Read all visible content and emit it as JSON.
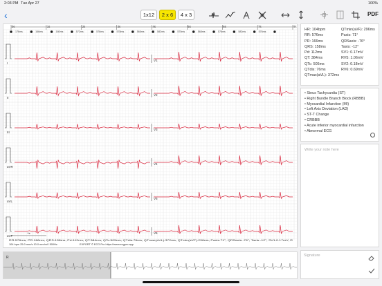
{
  "status_bar": {
    "time": "2:03 PM",
    "date": "Tue Apr 27",
    "battery": "100%"
  },
  "toolbar": {
    "back_label": "‹",
    "layouts": [
      "1x12",
      "2 x 6",
      "4 x 3"
    ],
    "active_layout": "2 x 6",
    "pdf_label": "PDF",
    "tools": [
      "waveform-icon",
      "trend-icon",
      "caliper-icon",
      "crossed-tool-icon",
      "horizontal-arrows-icon",
      "vertical-arrows-icon",
      "move-icon",
      "panel-icon",
      "crop-icon"
    ]
  },
  "ecg": {
    "time_marks": [
      "0s",
      "1s",
      "2s",
      "3s",
      "4s",
      "5s",
      "6s",
      "7s",
      "8s"
    ],
    "rr_labels": [
      "176ms",
      "166ms",
      "180ms",
      "572ms",
      "576ms",
      "578ms",
      "566ms",
      "582ms",
      "570ms",
      "568ms",
      "578ms",
      "582ms",
      "576ms",
      "580ms",
      "572ms",
      "574ms"
    ],
    "left_leads": [
      "I",
      "II",
      "III",
      "aVR",
      "aVL",
      "aVF"
    ],
    "right_leads": [
      "V1",
      "V2",
      "V3",
      "V4",
      "V5",
      "V6"
    ],
    "scale_label": "1s",
    "footer_line1": "RR:576ms; PR:166ms; QRS:158ms; Pd:112ms; QT:384ms; QTc:505ms; QTdis:76ms; QTmax(aVL):372ms; QTmin(aVF):296ms; Paxis:71°; QRSaxis:-76°; Taxis:-12°; SV1:0.17mV; R",
    "footer_line2": "104 bpm   25.0 mm/s  10.0 mm/mV   500Hz",
    "footer_line3": "EXPORT © ECG Pro https://www.ecgpro.app"
  },
  "measurements": {
    "left": [
      "HR: 104bpm",
      "RR: 576ms",
      "PR: 166ms",
      "QRS: 158ms",
      "Pd: 112ms",
      "QT: 384ms",
      "QTc: 505ms",
      "QTdis: 76ms",
      "QTmax(aVL): 372ms"
    ],
    "right": [
      "QTmin(aVF): 296ms",
      "Paxis: 71°",
      "QRSaxis: -76°",
      "Taxis: -12°",
      "SV1: 0.17mV",
      "RV5: 1.06mV",
      "SV2: 0.18mV",
      "RV6: 0.69mV"
    ]
  },
  "diagnoses": [
    "Sinus Tachycardia (ST)",
    "Right Bundle Branch Block (RBBB)",
    "Myocardial Infarction (MI)",
    "Left Axis Deviation (LAD)",
    "ST-T Change",
    "CRBBB",
    "Acute inferior myocardial infarction",
    "Abnormal ECG"
  ],
  "notes": {
    "placeholder": "Write your note here"
  },
  "signature": {
    "label": "Signature"
  },
  "strip": {
    "mark": "R"
  },
  "colors": {
    "ecg_trace": "#d8233a",
    "grid_minor": "#ededed",
    "grid_major": "#d9d9d9",
    "highlight": "#f7e600",
    "accent": "#1a6fd8"
  }
}
